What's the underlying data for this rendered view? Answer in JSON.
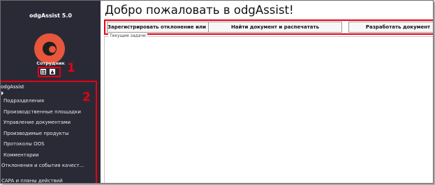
{
  "app": {
    "title": "odgAssist 5.0"
  },
  "user": {
    "role": "Сотрудник"
  },
  "header": {
    "title": "Добро пожаловать в odgAssist!"
  },
  "toolbar": {
    "buttons": [
      {
        "label": "Зарегистрировать отклонение или инцидент"
      },
      {
        "label": "Найти документ и распечатать"
      },
      {
        "label": "Разработать документ"
      }
    ]
  },
  "tasks": {
    "legend": "Текущие задачи"
  },
  "nav": {
    "root": "odgAssist",
    "items": [
      {
        "label": "Подразделения"
      },
      {
        "label": "Производственные площадки"
      },
      {
        "label": "Управление документами"
      },
      {
        "label": "Производимые продукты"
      },
      {
        "label": "Протоколы OOS"
      },
      {
        "label": "Комментарии"
      },
      {
        "label": "Отклонения и события качест..."
      },
      {
        "label": "CAPA и планы действий"
      }
    ]
  },
  "annotations": {
    "marker_1": "1",
    "marker_2": "2"
  },
  "colors": {
    "sidebar_bg": "#2a2a37",
    "logo": "#e8563b",
    "annotation_red": "#e60012"
  }
}
